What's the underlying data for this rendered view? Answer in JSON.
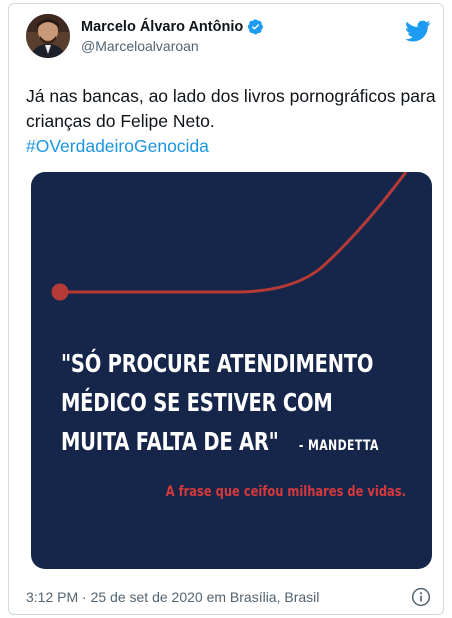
{
  "author": {
    "display_name": "Marcelo Álvaro Antônio",
    "handle": "@Marceloalvaroan",
    "verified": true
  },
  "tweet": {
    "text": "Já nas bancas, ao lado dos livros pornográficos para crianças do Felipe Neto.",
    "hashtag": "#OVerdadeiroGenocida"
  },
  "media": {
    "quote_lines": [
      "\"SÓ PROCURE ATENDIMENTO",
      "MÉDICO SE ESTIVER COM",
      "MUITA FALTA DE AR\""
    ],
    "quote_author": "- MANDETTA",
    "caption": "A frase que ceifou milhares de vidas.",
    "background_color": "#16264a",
    "curve_color": "#b53a36"
  },
  "footer": {
    "timestamp": "3:12 PM · 25 de set de 2020 em Brasília, Brasil"
  },
  "icons": [
    "verified-badge-icon",
    "twitter-bird-icon",
    "info-icon"
  ],
  "colors": {
    "accent": "#1b95e0",
    "caption_red": "#d6393b"
  }
}
